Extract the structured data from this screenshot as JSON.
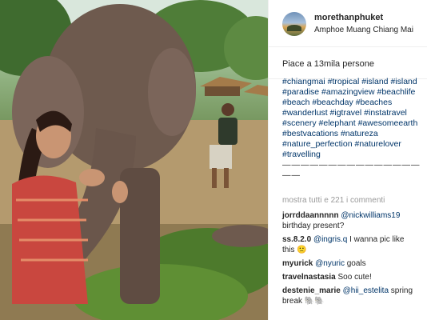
{
  "post": {
    "username": "morethanphuket",
    "location": "Amphoe Muang Chiang Mai",
    "likes_text": "Piace a 13mila persone"
  },
  "caption": {
    "lines": [
      [
        "#chiangmai",
        "#tropical",
        "#island",
        "#island"
      ],
      [
        "#paradise",
        "#amazingview",
        "#beachlife"
      ],
      [
        "#beach",
        "#beachday",
        "#beaches"
      ],
      [
        "#wanderlust",
        "#igtravel",
        "#instatravel"
      ],
      [
        "#scenery",
        "#elephant",
        "#awesomeearth"
      ],
      [
        "#bestvacations",
        "#natureza"
      ],
      [
        "#nature_perfection",
        "#naturelover"
      ],
      [
        "#travelling"
      ]
    ],
    "rule_1": "———————————————",
    "rule_2": "——"
  },
  "comments_link": "mostra tutti e 221 i commenti",
  "comments": [
    {
      "user": "jorrddaannnnn",
      "mention": "@nickwilliams19",
      "text": "",
      "text2": "birthday present?"
    },
    {
      "user": "ss.8.2.0",
      "mention": "@ingris.q",
      "text": "I wanna pic like",
      "text2": "this 🙁"
    },
    {
      "user": "myurick",
      "mention": "@nyuric",
      "text": "goals",
      "text2": ""
    },
    {
      "user": "travelnastasia",
      "mention": "",
      "text": "Soo cute!",
      "text2": ""
    },
    {
      "user": "destenie_marie",
      "mention": "@hii_estelita",
      "text": "spring",
      "text2": "break 🐘🐘"
    }
  ],
  "colors": {
    "link": "#003569",
    "muted": "#999999",
    "text": "#262626"
  }
}
